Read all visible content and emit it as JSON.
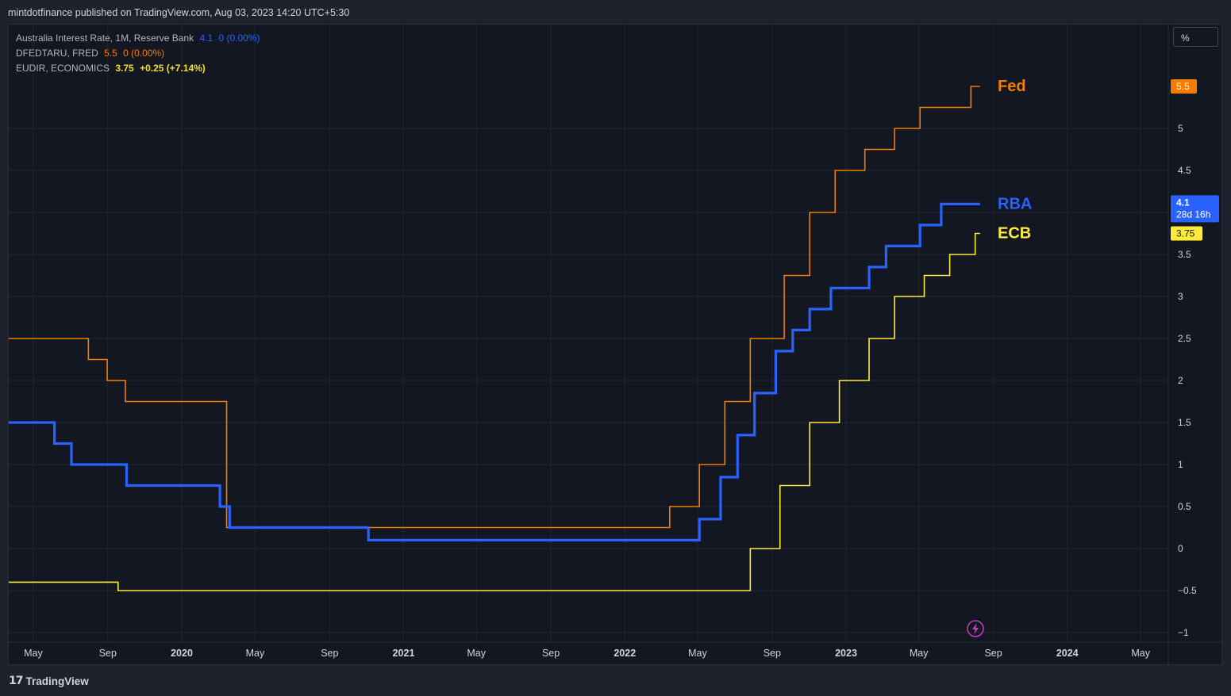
{
  "header": {
    "publisher_line": "mintdotfinance published on TradingView.com, Aug 03, 2023 14:20 UTC+5:30"
  },
  "legend": [
    {
      "name": "Australia Interest Rate, 1M, Reserve Bank",
      "value": "4.1",
      "change": "0 (0.00%)",
      "color": "#2962ff"
    },
    {
      "name": "DFEDTARU, FRED",
      "value": "5.5",
      "change": "0 (0.00%)",
      "color": "#f57c00"
    },
    {
      "name": "EUDIR, ECONOMICS",
      "value": "3.75",
      "change": "+0.25 (+7.14%)",
      "color": "#f0e130"
    }
  ],
  "scale_button": "%",
  "footer": {
    "brand": "TradingView",
    "logo_mark": "17"
  },
  "colors": {
    "rba": "#2962ff",
    "fed": "#f57c00",
    "ecb": "#ffeb3b",
    "background": "#131722",
    "grid": "#1f2330",
    "text": "#d1d4dc"
  },
  "chart_data": {
    "type": "line",
    "step": true,
    "y_axis": {
      "range": [
        -1,
        5.85
      ],
      "ticks": [
        -1,
        -0.5,
        0,
        0.5,
        1,
        1.5,
        2,
        2.5,
        3,
        3.5,
        4,
        4.5,
        5
      ],
      "tick_labels": [
        "−1",
        "−0.5",
        "0",
        "0.5",
        "1",
        "1.5",
        "2",
        "2.5",
        "3",
        "3.5",
        "4",
        "4.5",
        "5"
      ],
      "position": "right"
    },
    "x_axis": {
      "range": [
        "2019-03-20",
        "2024-06-20"
      ],
      "ticks": [
        {
          "date": "2019-05-01",
          "label": "May",
          "bold": false
        },
        {
          "date": "2019-09-01",
          "label": "Sep",
          "bold": false
        },
        {
          "date": "2020-01-01",
          "label": "2020",
          "bold": true
        },
        {
          "date": "2020-05-01",
          "label": "May",
          "bold": false
        },
        {
          "date": "2020-09-01",
          "label": "Sep",
          "bold": false
        },
        {
          "date": "2021-01-01",
          "label": "2021",
          "bold": true
        },
        {
          "date": "2021-05-01",
          "label": "May",
          "bold": false
        },
        {
          "date": "2021-09-01",
          "label": "Sep",
          "bold": false
        },
        {
          "date": "2022-01-01",
          "label": "2022",
          "bold": true
        },
        {
          "date": "2022-05-01",
          "label": "May",
          "bold": false
        },
        {
          "date": "2022-09-01",
          "label": "Sep",
          "bold": false
        },
        {
          "date": "2023-01-01",
          "label": "2023",
          "bold": true
        },
        {
          "date": "2023-05-01",
          "label": "May",
          "bold": false
        },
        {
          "date": "2023-09-01",
          "label": "Sep",
          "bold": false
        },
        {
          "date": "2024-01-01",
          "label": "2024",
          "bold": true
        },
        {
          "date": "2024-05-01",
          "label": "May",
          "bold": false
        }
      ]
    },
    "series": [
      {
        "name": "Fed",
        "color": "#f57c00",
        "width": 1.6,
        "label": "Fed",
        "price_label": "5.5",
        "points": [
          [
            "2019-03-20",
            2.5
          ],
          [
            "2019-07-31",
            2.25
          ],
          [
            "2019-08-31",
            2.0
          ],
          [
            "2019-09-30",
            1.75
          ],
          [
            "2020-03-03",
            1.75
          ],
          [
            "2020-03-15",
            0.25
          ],
          [
            "2022-03-16",
            0.5
          ],
          [
            "2022-05-04",
            1.0
          ],
          [
            "2022-06-15",
            1.75
          ],
          [
            "2022-07-27",
            2.5
          ],
          [
            "2022-09-21",
            3.25
          ],
          [
            "2022-11-02",
            4.0
          ],
          [
            "2022-12-14",
            4.5
          ],
          [
            "2023-02-01",
            4.75
          ],
          [
            "2023-03-22",
            5.0
          ],
          [
            "2023-05-03",
            5.25
          ],
          [
            "2023-07-26",
            5.5
          ],
          [
            "2023-08-10",
            5.5
          ]
        ]
      },
      {
        "name": "RBA",
        "color": "#2962ff",
        "width": 3.2,
        "label": "RBA",
        "price_label": "4.1",
        "price_sublabel": "28d 16h",
        "points": [
          [
            "2019-03-20",
            1.5
          ],
          [
            "2019-06-05",
            1.25
          ],
          [
            "2019-07-03",
            1.0
          ],
          [
            "2019-10-02",
            0.75
          ],
          [
            "2020-03-04",
            0.5
          ],
          [
            "2020-03-20",
            0.25
          ],
          [
            "2020-11-04",
            0.1
          ],
          [
            "2022-05-04",
            0.35
          ],
          [
            "2022-06-08",
            0.85
          ],
          [
            "2022-07-06",
            1.35
          ],
          [
            "2022-08-03",
            1.85
          ],
          [
            "2022-09-07",
            2.35
          ],
          [
            "2022-10-05",
            2.6
          ],
          [
            "2022-11-02",
            2.85
          ],
          [
            "2022-12-07",
            3.1
          ],
          [
            "2023-02-08",
            3.35
          ],
          [
            "2023-03-08",
            3.6
          ],
          [
            "2023-05-03",
            3.85
          ],
          [
            "2023-06-07",
            4.1
          ],
          [
            "2023-08-10",
            4.1
          ]
        ]
      },
      {
        "name": "ECB",
        "color": "#ffeb3b",
        "width": 1.6,
        "label": "ECB",
        "price_label": "3.75",
        "points": [
          [
            "2019-03-20",
            -0.4
          ],
          [
            "2019-09-18",
            -0.5
          ],
          [
            "2022-07-27",
            0.0
          ],
          [
            "2022-09-14",
            0.75
          ],
          [
            "2022-11-02",
            1.5
          ],
          [
            "2022-12-21",
            2.0
          ],
          [
            "2023-02-08",
            2.5
          ],
          [
            "2023-03-22",
            3.0
          ],
          [
            "2023-05-10",
            3.25
          ],
          [
            "2023-06-21",
            3.5
          ],
          [
            "2023-08-02",
            3.75
          ],
          [
            "2023-08-10",
            3.75
          ]
        ]
      }
    ],
    "series_labels": [
      "Fed",
      "RBA",
      "ECB"
    ]
  }
}
